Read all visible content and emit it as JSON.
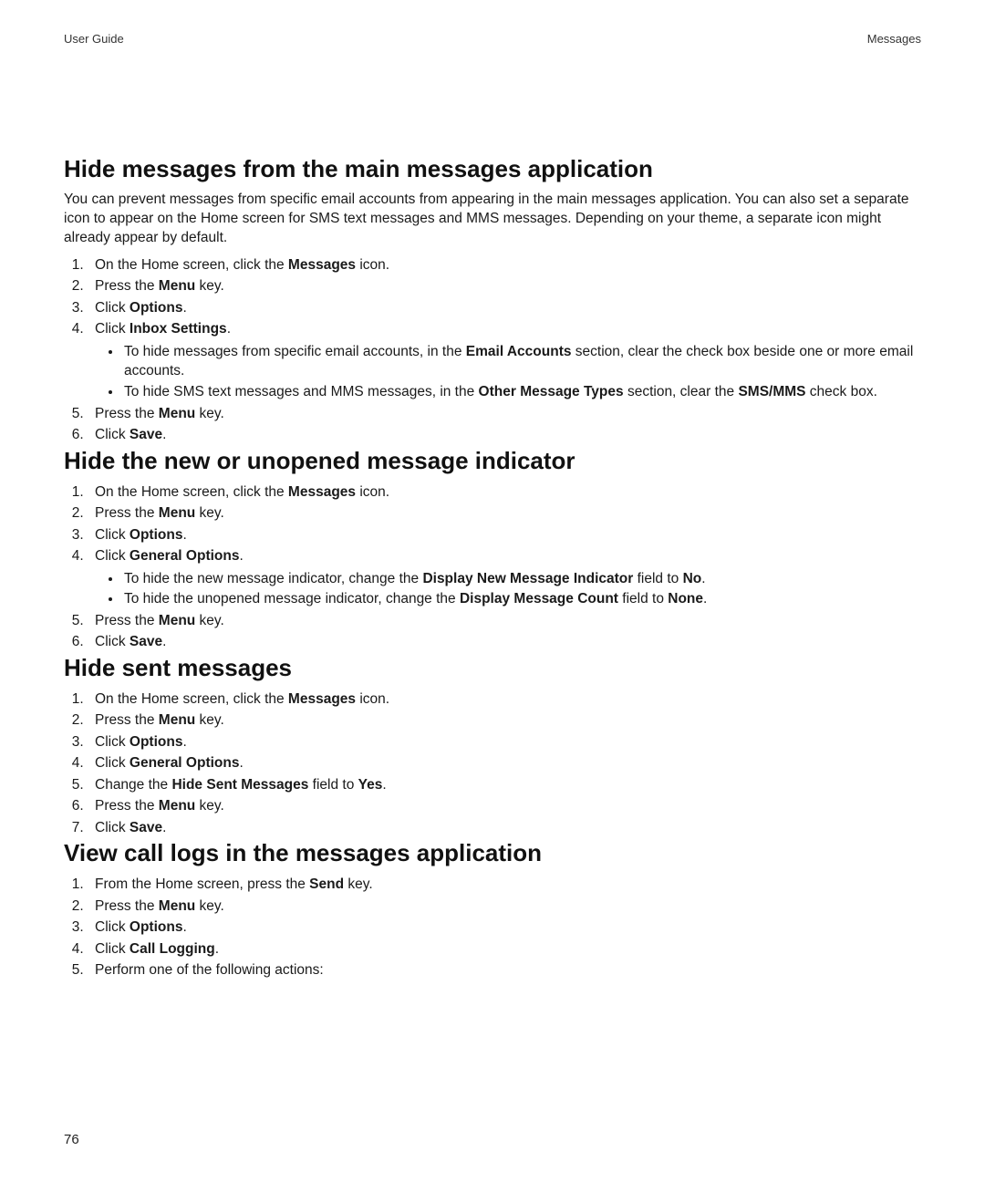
{
  "header": {
    "left": "User Guide",
    "right": "Messages"
  },
  "page_number": "76",
  "sections": [
    {
      "title": "Hide messages from the main messages application",
      "intro": "You can prevent messages from specific email accounts from appearing in the main messages application. You can also set a separate icon to appear on the Home screen for SMS text messages and MMS messages. Depending on your theme, a separate icon might already appear by default.",
      "steps": [
        {
          "pre": "On the Home screen, click the ",
          "bold": "Messages",
          "post": " icon."
        },
        {
          "pre": "Press the ",
          "bold": "Menu",
          "post": " key."
        },
        {
          "pre": "Click ",
          "bold": "Options",
          "post": "."
        },
        {
          "pre": "Click ",
          "bold": "Inbox Settings",
          "post": ".",
          "bullets": [
            {
              "pre": "To hide messages from specific email accounts, in the ",
              "bold": "Email Accounts",
              "post": " section, clear the check box beside one or more email accounts."
            },
            {
              "pre": "To hide SMS text messages and MMS messages, in the ",
              "bold": "Other Message Types",
              "post": " section, clear the ",
              "bold2": "SMS/MMS",
              "post2": " check box."
            }
          ]
        },
        {
          "pre": "Press the ",
          "bold": "Menu",
          "post": " key."
        },
        {
          "pre": "Click ",
          "bold": "Save",
          "post": "."
        }
      ]
    },
    {
      "title": "Hide the new or unopened message indicator",
      "steps": [
        {
          "pre": "On the Home screen, click the ",
          "bold": "Messages",
          "post": " icon."
        },
        {
          "pre": "Press the ",
          "bold": "Menu",
          "post": " key."
        },
        {
          "pre": "Click ",
          "bold": "Options",
          "post": "."
        },
        {
          "pre": "Click ",
          "bold": "General Options",
          "post": ".",
          "bullets": [
            {
              "pre": "To hide the new message indicator, change the ",
              "bold": "Display New Message Indicator",
              "post": " field to ",
              "bold2": "No",
              "post2": "."
            },
            {
              "pre": "To hide the unopened message indicator, change the ",
              "bold": "Display Message Count",
              "post": " field to ",
              "bold2": "None",
              "post2": "."
            }
          ]
        },
        {
          "pre": "Press the ",
          "bold": "Menu",
          "post": " key."
        },
        {
          "pre": "Click ",
          "bold": "Save",
          "post": "."
        }
      ]
    },
    {
      "title": "Hide sent messages",
      "steps": [
        {
          "pre": "On the Home screen, click the ",
          "bold": "Messages",
          "post": " icon."
        },
        {
          "pre": "Press the ",
          "bold": "Menu",
          "post": " key."
        },
        {
          "pre": "Click ",
          "bold": "Options",
          "post": "."
        },
        {
          "pre": "Click ",
          "bold": "General Options",
          "post": "."
        },
        {
          "pre": "Change the ",
          "bold": "Hide Sent Messages",
          "post": " field to ",
          "bold2": "Yes",
          "post2": "."
        },
        {
          "pre": "Press the ",
          "bold": "Menu",
          "post": " key."
        },
        {
          "pre": "Click ",
          "bold": "Save",
          "post": "."
        }
      ]
    },
    {
      "title": "View call logs in the messages application",
      "steps": [
        {
          "pre": "From the Home screen, press the ",
          "bold": "Send",
          "post": " key."
        },
        {
          "pre": "Press the ",
          "bold": "Menu",
          "post": " key."
        },
        {
          "pre": "Click ",
          "bold": "Options",
          "post": "."
        },
        {
          "pre": "Click ",
          "bold": "Call Logging",
          "post": "."
        },
        {
          "pre": "Perform one of the following actions:"
        }
      ]
    }
  ]
}
